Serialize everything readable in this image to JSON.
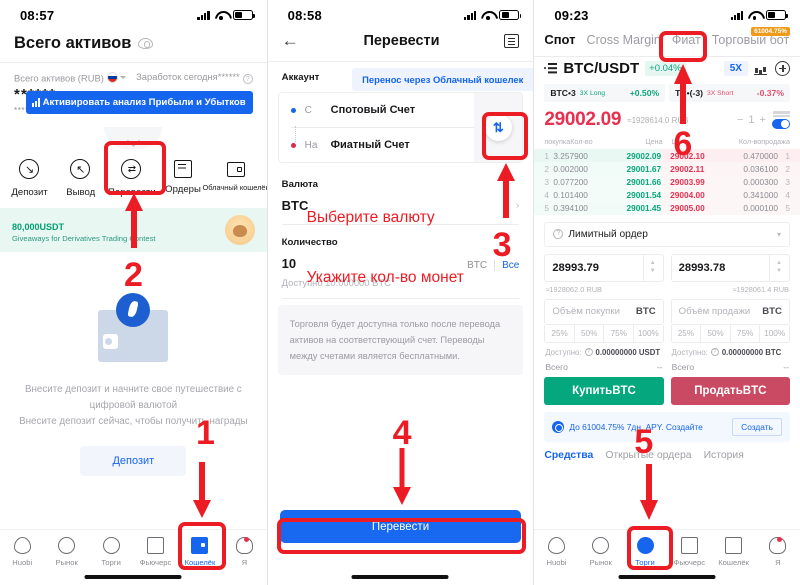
{
  "panel1": {
    "status": {
      "time": "08:57"
    },
    "title": "Всего активов",
    "assets": {
      "label": "Всего активов (RUB)",
      "earnings_label": "Заработок сегодня",
      "earnings_value": "******",
      "masked_value": "******",
      "masked_sub": "*****",
      "pnl_button": "Активировать анализ Прибыли и Убытков"
    },
    "actions": [
      {
        "label": "Депозит",
        "icon": "arrow-down-circle-icon"
      },
      {
        "label": "Вывод",
        "icon": "arrow-up-circle-icon"
      },
      {
        "label": "Перевести",
        "icon": "transfer-circle-icon"
      },
      {
        "label": "Ордеры",
        "icon": "orders-icon"
      },
      {
        "label": "Облачный кошелёк",
        "icon": "cloud-wallet-icon"
      }
    ],
    "promo": {
      "amount": "80,000",
      "currency": "USDT",
      "subtitle": "Giveaways for Derivatives Trading Contest"
    },
    "empty": {
      "line1": "Внесите депозит и начните свое путешествие с",
      "line2": "цифровой валютой",
      "line3": "Внесите депозит сейчас, чтобы получить награды",
      "button": "Депозит"
    },
    "nav": [
      {
        "label": "Huobi",
        "icon": "flame-icon",
        "active": false
      },
      {
        "label": "Рынок",
        "icon": "market-icon",
        "active": false
      },
      {
        "label": "Торги",
        "icon": "trade-icon",
        "active": false
      },
      {
        "label": "Фьючерс",
        "icon": "futures-icon",
        "active": false
      },
      {
        "label": "Кошелёк",
        "icon": "wallet-icon",
        "active": true
      },
      {
        "label": "Я",
        "icon": "profile-icon",
        "active": false
      }
    ]
  },
  "panel2": {
    "status": {
      "time": "08:58"
    },
    "nav_title": "Перевести",
    "back_icon": "back-arrow-icon",
    "records_icon": "records-icon",
    "account_label": "Аккаунт",
    "cloud_link": "Перенос через Облачный кошелек",
    "from_prefix": "С",
    "from_account": "Спотовый Счет",
    "to_prefix": "На",
    "to_account": "Фиатный Счет",
    "swap_icon": "swap-vertical-icon",
    "currency_label": "Валюта",
    "currency_code": "BTC",
    "amount_label": "Количество",
    "amount_value": "10",
    "amount_unit": "BTC",
    "amount_all": "Все",
    "available": "Доступно  10.000000 BTC",
    "note": "Торговля будет доступна только после перевода активов на соответствующий счет. Переводы между счетами является бесплатными.",
    "submit": "Перевести"
  },
  "panel3": {
    "status": {
      "time": "09:23"
    },
    "tabs": [
      {
        "label": "Спот",
        "active": true
      },
      {
        "label": "Cross Margin",
        "active": false
      },
      {
        "label": "Фиат",
        "active": false
      },
      {
        "label": "Торговый бот",
        "active": false
      }
    ],
    "apy_badge": "61004.75%",
    "pair": "BTC/USDT",
    "pair_change": "+0.04%",
    "leverage": "5X",
    "lev_cards": [
      {
        "name": "BTC•3",
        "tag": "3X Long",
        "value": "+0.50%",
        "dir": "up"
      },
      {
        "name": "TC•(-3)",
        "tag": "3X Short",
        "value": "-0.37%",
        "dir": "dn"
      }
    ],
    "last_price": "29002.09",
    "last_price_fiat": "≈1928614.0 RUB",
    "stepper_value": "1",
    "orderbook": {
      "headers": [
        "покупка",
        "Кол-во",
        "Цена",
        "Цена",
        "Кол-во",
        "продажа"
      ],
      "bids": [
        {
          "i": "1",
          "qty": "3.257900",
          "price": "29002.09"
        },
        {
          "i": "2",
          "qty": "0.002000",
          "price": "29001.67"
        },
        {
          "i": "3",
          "qty": "0.077200",
          "price": "29001.66"
        },
        {
          "i": "4",
          "qty": "0.101400",
          "price": "29001.54"
        },
        {
          "i": "5",
          "qty": "0.394100",
          "price": "29001.45"
        }
      ],
      "asks": [
        {
          "i": "1",
          "price": "29002.10",
          "qty": "0.470000"
        },
        {
          "i": "2",
          "price": "29002.11",
          "qty": "0.036100"
        },
        {
          "i": "3",
          "price": "29003.99",
          "qty": "0.000300"
        },
        {
          "i": "4",
          "price": "29004.00",
          "qty": "0.341000"
        },
        {
          "i": "5",
          "price": "29005.00",
          "qty": "0.000100"
        }
      ]
    },
    "order_type": "Лимитный ордер",
    "buy_side": {
      "price": "28993.79",
      "price_fiat": "≈1928062.0 RUB",
      "volume_placeholder": "Объём покупки",
      "volume_unit": "BTC",
      "percents": [
        "25%",
        "50%",
        "75%",
        "100%"
      ],
      "avail_label": "Доступно:",
      "avail_value": "0.00000000 USDT",
      "total_label": "Всего",
      "total_value": "--",
      "button": "КупитьBTC"
    },
    "sell_side": {
      "price": "28993.78",
      "price_fiat": "≈1928061.4 RUB",
      "volume_placeholder": "Объём продажи",
      "volume_unit": "BTC",
      "percents": [
        "25%",
        "50%",
        "75%",
        "100%"
      ],
      "avail_label": "Доступно:",
      "avail_value": "0.00000000 BTC",
      "total_label": "Всего",
      "total_value": "--",
      "button": "ПродатьBTC"
    },
    "apy_bar": {
      "text": "До 61004.75% 7дн. APY. Создайте",
      "button": "Создать"
    },
    "order_tabs": [
      {
        "label": "Средства",
        "active": true
      },
      {
        "label": "Открытые ордера",
        "active": false
      },
      {
        "label": "История",
        "active": false
      }
    ],
    "nav": [
      {
        "label": "Huobi",
        "icon": "flame-icon",
        "active": false
      },
      {
        "label": "Рынок",
        "icon": "market-icon",
        "active": false
      },
      {
        "label": "Торги",
        "icon": "trade-icon",
        "active": true
      },
      {
        "label": "Фьючерс",
        "icon": "futures-icon",
        "active": false
      },
      {
        "label": "Кошелёк",
        "icon": "wallet-icon",
        "active": false
      },
      {
        "label": "Я",
        "icon": "profile-icon",
        "active": false
      }
    ]
  },
  "annotations": {
    "step1": "1",
    "step2": "2",
    "step3": "3",
    "step4": "4",
    "step5": "5",
    "step6": "6",
    "note_currency": "Выберите валюту",
    "note_amount": "Укажите кол-во монет"
  }
}
